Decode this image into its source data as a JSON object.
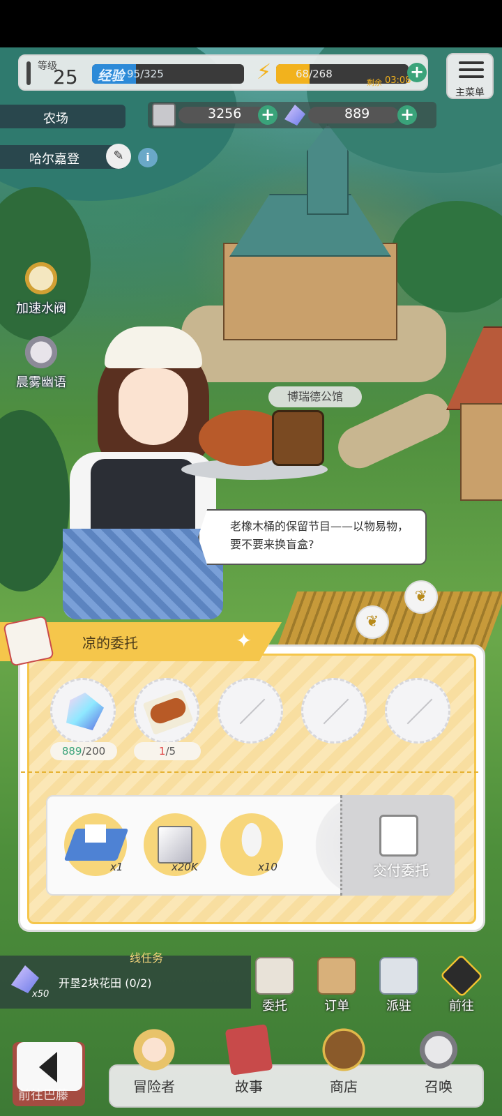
{
  "hud": {
    "level_label": "等级",
    "level": "25",
    "exp_label": "经验",
    "exp": "95/325",
    "exp_fraction": 0.29,
    "energy": "68/268",
    "energy_fraction": 0.25,
    "energy_timer_label": "剩余",
    "energy_timer": "03:08",
    "menu_label": "主菜单",
    "coins": "3256",
    "gems": "889"
  },
  "location": {
    "area": "农场",
    "name": "哈尔嘉登"
  },
  "side_buttons": [
    {
      "label": "加速水阀",
      "icon": "stopwatch-icon"
    },
    {
      "label": "晨雾幽语",
      "icon": "character-portrait-icon"
    }
  ],
  "map_label": "博瑞德公馆",
  "npc_dialogue": "老橡木桶的保留节目——以物易物，要不要来换盲盒?",
  "commission": {
    "title": "凉的委托",
    "requirements": [
      {
        "icon": "gem-icon",
        "have": "889",
        "need": "/200"
      },
      {
        "icon": "bread-icon",
        "have": "1",
        "need": "/5"
      },
      {
        "icon": "empty-slot",
        "have": null,
        "need": null
      },
      {
        "icon": "empty-slot",
        "have": null,
        "need": null
      },
      {
        "icon": "empty-slot",
        "have": null,
        "need": null
      }
    ],
    "rewards": [
      {
        "icon": "blueprint-house-icon",
        "qty": "x1"
      },
      {
        "icon": "metal-block-icon",
        "qty": "x20K"
      },
      {
        "icon": "herb-sprig-icon",
        "qty": "x10"
      }
    ],
    "deliver_label": "交付委托"
  },
  "quest": {
    "tag": "线任务",
    "reward_qty": "x50",
    "text": "开垦2块花田 (0/2)"
  },
  "actions": [
    {
      "label": "委托",
      "icon": "notepad-icon"
    },
    {
      "label": "订单",
      "icon": "box-icon"
    },
    {
      "label": "派驻",
      "icon": "map-pin-icon"
    },
    {
      "label": "前往",
      "icon": "direction-sign-icon"
    }
  ],
  "tabs": [
    {
      "label": "冒险者",
      "icon": "adventurer-icon"
    },
    {
      "label": "故事",
      "icon": "book-icon"
    },
    {
      "label": "商店",
      "icon": "shop-bag-icon"
    },
    {
      "label": "召唤",
      "icon": "summon-icon"
    }
  ],
  "back_label": "前往巴藤"
}
